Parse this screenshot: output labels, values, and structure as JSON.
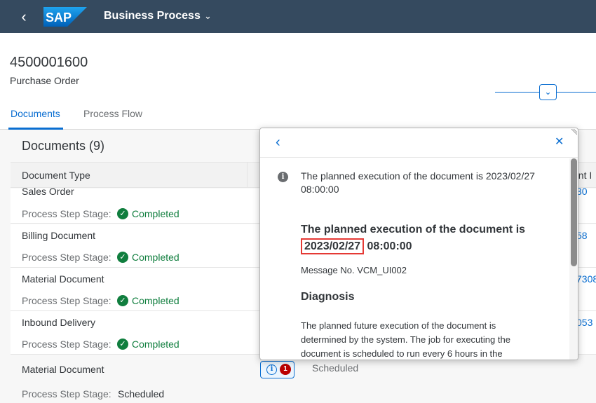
{
  "shell": {
    "logo_text": "SAP",
    "title": "Business Process"
  },
  "object": {
    "id": "4500001600",
    "type": "Purchase Order"
  },
  "tabs": [
    {
      "label": "Documents",
      "selected": true
    },
    {
      "label": "Process Flow",
      "selected": false
    }
  ],
  "documents": {
    "title": "Documents (9)",
    "columns": {
      "doc_type": "Document Type",
      "doc_id_partial": "ent I"
    },
    "rows": [
      {
        "type": "Sales Order",
        "stage_label": "Process Step Stage:",
        "status": "Completed",
        "id_partial": "30"
      },
      {
        "type": "Billing Document",
        "stage_label": "Process Step Stage:",
        "status": "Completed",
        "id_partial": "58"
      },
      {
        "type": "Material Document",
        "stage_label": "Process Step Stage:",
        "status": "Completed",
        "id_partial": "7308"
      },
      {
        "type": "Inbound Delivery",
        "stage_label": "Process Step Stage:",
        "status": "Completed",
        "id_partial": "053"
      }
    ],
    "last_row": {
      "type": "Material Document",
      "stage_label": "Process Step Stage:",
      "stage_value": "Scheduled",
      "status": "Scheduled",
      "message_count": "1"
    }
  },
  "popover": {
    "message": "The planned execution of the document is 2023/02/27 08:00:00",
    "heading_prefix": "The planned execution of the document is",
    "heading_date": "2023/02/27",
    "heading_time": "08:00:00",
    "message_no": "Message No. VCM_UI002",
    "diagnosis_title": "Diagnosis",
    "diagnosis_text": "The planned future execution of the document is determined by the system. The job for executing the document is scheduled to run every 6 hours in the"
  },
  "colors": {
    "shell": "#354a5f",
    "accent": "#0a6ed1",
    "success": "#107e3e",
    "error": "#bb0000",
    "highlight": "#e53935"
  }
}
